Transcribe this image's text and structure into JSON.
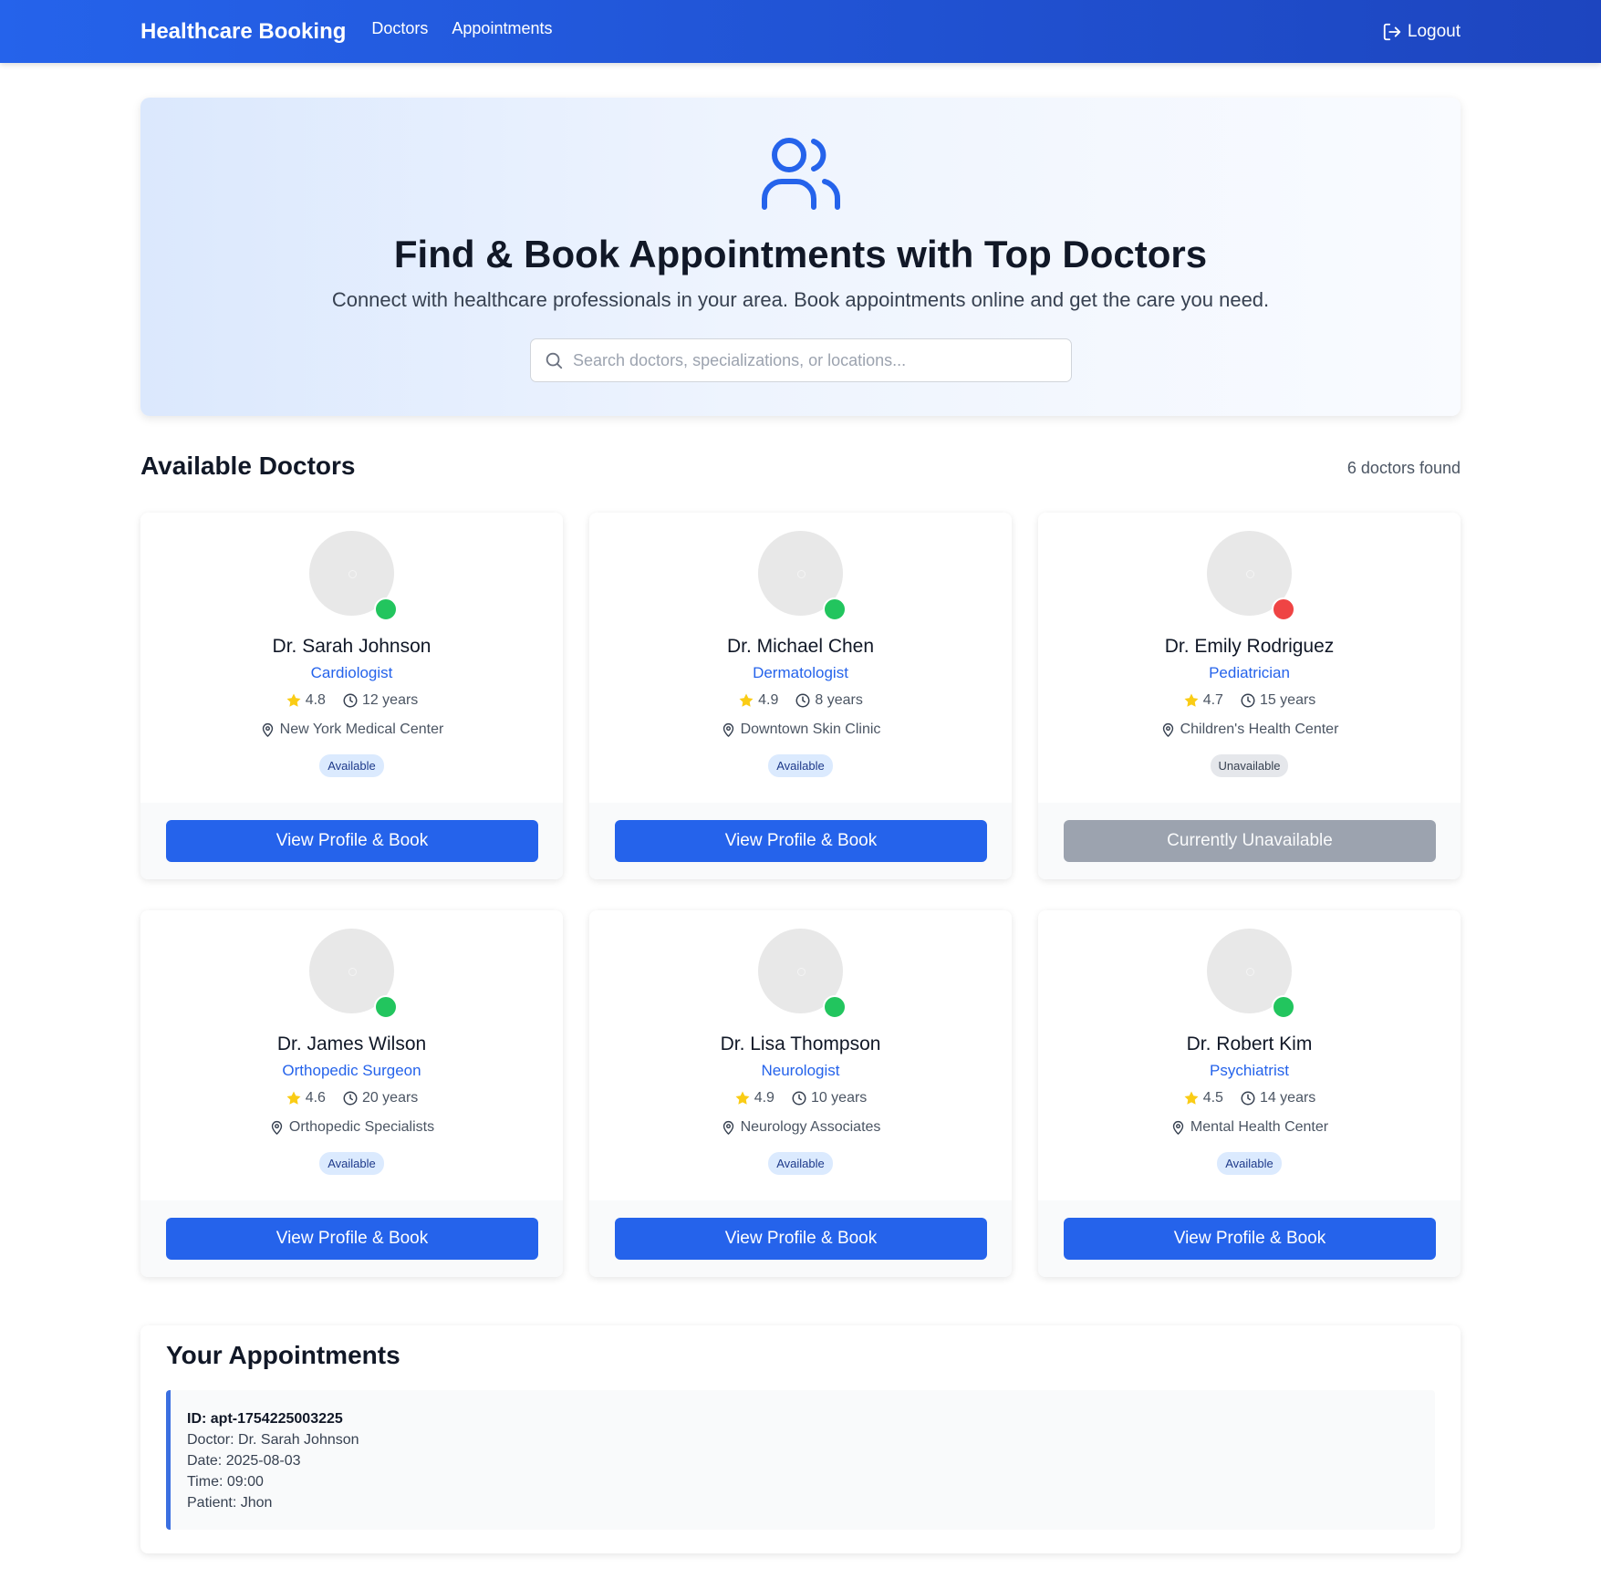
{
  "nav": {
    "brand": "Healthcare Booking",
    "links": [
      "Doctors",
      "Appointments"
    ],
    "logout": "Logout"
  },
  "hero": {
    "icon": "users-icon",
    "title": "Find & Book Appointments with Top Doctors",
    "subtitle": "Connect with healthcare professionals in your area. Book appointments online and get the care you need.",
    "search_placeholder": "Search doctors, specializations, or locations...",
    "search_value": ""
  },
  "doctors_section": {
    "title": "Available Doctors",
    "count": "6 doctors found"
  },
  "doctors": [
    {
      "name": "Dr. Sarah Johnson",
      "specialty": "Cardiologist",
      "rating": "4.8",
      "experience": "12 years",
      "location": "New York Medical Center",
      "status": "Available",
      "available": true,
      "button": "View Profile & Book"
    },
    {
      "name": "Dr. Michael Chen",
      "specialty": "Dermatologist",
      "rating": "4.9",
      "experience": "8 years",
      "location": "Downtown Skin Clinic",
      "status": "Available",
      "available": true,
      "button": "View Profile & Book"
    },
    {
      "name": "Dr. Emily Rodriguez",
      "specialty": "Pediatrician",
      "rating": "4.7",
      "experience": "15 years",
      "location": "Children's Health Center",
      "status": "Unavailable",
      "available": false,
      "button": "Currently Unavailable"
    },
    {
      "name": "Dr. James Wilson",
      "specialty": "Orthopedic Surgeon",
      "rating": "4.6",
      "experience": "20 years",
      "location": "Orthopedic Specialists",
      "status": "Available",
      "available": true,
      "button": "View Profile & Book"
    },
    {
      "name": "Dr. Lisa Thompson",
      "specialty": "Neurologist",
      "rating": "4.9",
      "experience": "10 years",
      "location": "Neurology Associates",
      "status": "Available",
      "available": true,
      "button": "View Profile & Book"
    },
    {
      "name": "Dr. Robert Kim",
      "specialty": "Psychiatrist",
      "rating": "4.5",
      "experience": "14 years",
      "location": "Mental Health Center",
      "status": "Available",
      "available": true,
      "button": "View Profile & Book"
    }
  ],
  "appointments": {
    "title": "Your Appointments",
    "items": [
      {
        "id": "ID: apt-1754225003225",
        "doctor": "Doctor: Dr. Sarah Johnson",
        "date": "Date: 2025-08-03",
        "time": "Time: 09:00",
        "patient": "Patient: Jhon"
      }
    ]
  },
  "colors": {
    "accent": "#2563eb",
    "available_dot": "#22c55e",
    "unavailable_dot": "#ef4444",
    "star": "#facc15"
  }
}
